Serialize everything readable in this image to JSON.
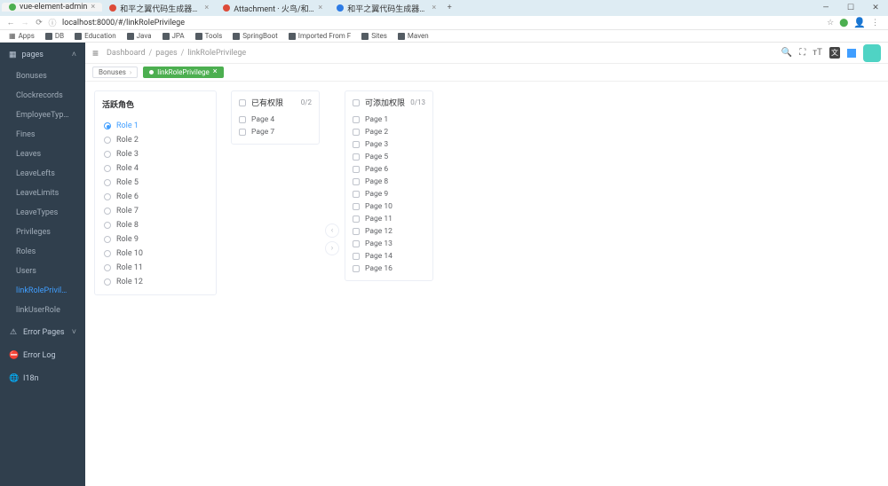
{
  "browser": {
    "tabs": [
      {
        "title": "vue-element-admin",
        "color": "#4caf50"
      },
      {
        "title": "和平之翼代码生成器SME",
        "color": "#dd4b39"
      },
      {
        "title": "Attachment · 火鸟/和平之…",
        "color": "#dd4b39"
      },
      {
        "title": "和平之翼代码生成器SME",
        "color": "#2c7be5"
      }
    ],
    "url": "localhost:8000/#/linkRolePrivilege",
    "bookmarks": [
      "Apps",
      "DB",
      "Education",
      "Java",
      "JPA",
      "Tools",
      "SpringBoot",
      "Imported From F",
      "Sites",
      "Maven"
    ]
  },
  "sidebar": {
    "header": "pages",
    "items": [
      {
        "label": "Bonuses"
      },
      {
        "label": "Clockrecords"
      },
      {
        "label": "EmployeeTypes"
      },
      {
        "label": "Fines"
      },
      {
        "label": "Leaves"
      },
      {
        "label": "LeaveLefts"
      },
      {
        "label": "LeaveLimits"
      },
      {
        "label": "LeaveTypes"
      },
      {
        "label": "Privileges"
      },
      {
        "label": "Roles"
      },
      {
        "label": "Users"
      },
      {
        "label": "linkRolePrivilege",
        "active": true
      },
      {
        "label": "linkUserRole"
      }
    ],
    "groups": [
      {
        "icon": "⚠",
        "label": "Error Pages",
        "expandable": true
      },
      {
        "icon": "⛔",
        "label": "Error Log"
      },
      {
        "icon": "🌐",
        "label": "I18n"
      }
    ]
  },
  "breadcrumb": {
    "a": "Dashboard",
    "b": "pages",
    "c": "linkRolePrivilege"
  },
  "tags": {
    "first": "Bonuses",
    "active": "linkRolePrivilege"
  },
  "roles": {
    "title": "活跃角色",
    "items": [
      "Role 1",
      "Role 2",
      "Role 3",
      "Role 4",
      "Role 5",
      "Role 6",
      "Role 7",
      "Role 8",
      "Role 9",
      "Role 10",
      "Role 11",
      "Role 12"
    ],
    "selected": "Role 1"
  },
  "assigned": {
    "title": "已有权限",
    "count": "0/2",
    "items": [
      "Page 4",
      "Page 7"
    ]
  },
  "available": {
    "title": "可添加权限",
    "count": "0/13",
    "items": [
      "Page 1",
      "Page 2",
      "Page 3",
      "Page 5",
      "Page 6",
      "Page 8",
      "Page 9",
      "Page 10",
      "Page 11",
      "Page 12",
      "Page 13",
      "Page 14",
      "Page 16"
    ]
  }
}
